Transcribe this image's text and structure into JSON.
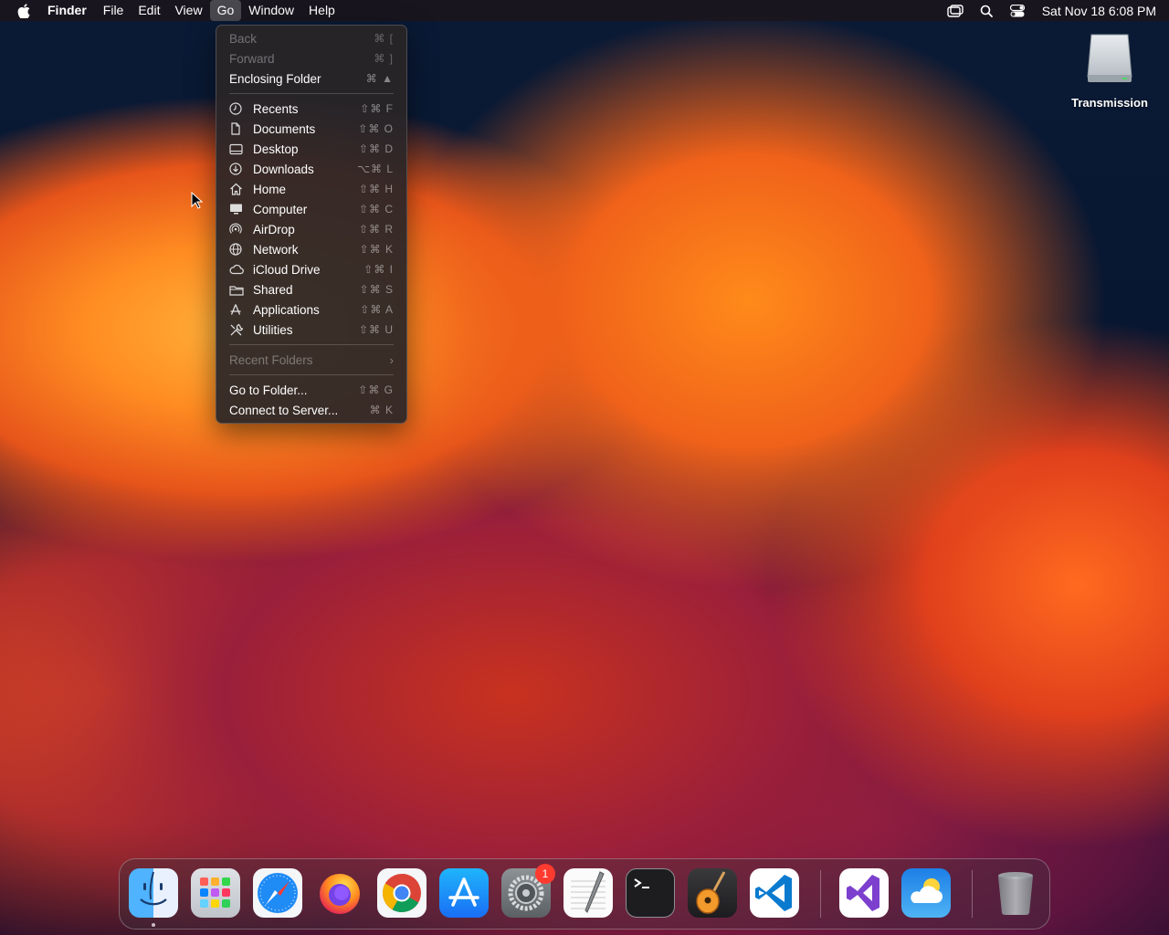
{
  "menubar": {
    "app_name": "Finder",
    "items": [
      "File",
      "Edit",
      "View",
      "Go",
      "Window",
      "Help"
    ],
    "active_item": "Go",
    "clock": "Sat Nov 18  6:08 PM",
    "status_icons": [
      "screen-mirroring-icon",
      "spotlight-search-icon",
      "control-center-icon"
    ]
  },
  "go_menu": {
    "back": {
      "label": "Back",
      "shortcut": "⌘ ["
    },
    "forward": {
      "label": "Forward",
      "shortcut": "⌘ ]"
    },
    "enclosing": {
      "label": "Enclosing Folder",
      "shortcut": "⌘ ▲"
    },
    "places": [
      {
        "label": "Recents",
        "shortcut": "⇧⌘ F",
        "icon": "clock-icon"
      },
      {
        "label": "Documents",
        "shortcut": "⇧⌘ O",
        "icon": "document-icon"
      },
      {
        "label": "Desktop",
        "shortcut": "⇧⌘ D",
        "icon": "desktop-icon"
      },
      {
        "label": "Downloads",
        "shortcut": "⌥⌘ L",
        "icon": "download-icon"
      },
      {
        "label": "Home",
        "shortcut": "⇧⌘ H",
        "icon": "home-icon"
      },
      {
        "label": "Computer",
        "shortcut": "⇧⌘ C",
        "icon": "computer-icon"
      },
      {
        "label": "AirDrop",
        "shortcut": "⇧⌘ R",
        "icon": "airdrop-icon"
      },
      {
        "label": "Network",
        "shortcut": "⇧⌘ K",
        "icon": "globe-icon"
      },
      {
        "label": "iCloud Drive",
        "shortcut": "⇧⌘ I",
        "icon": "cloud-icon"
      },
      {
        "label": "Shared",
        "shortcut": "⇧⌘ S",
        "icon": "shared-folder-icon"
      },
      {
        "label": "Applications",
        "shortcut": "⇧⌘ A",
        "icon": "applications-icon"
      },
      {
        "label": "Utilities",
        "shortcut": "⇧⌘ U",
        "icon": "utilities-icon"
      }
    ],
    "recent_folders": {
      "label": "Recent Folders"
    },
    "go_to_folder": {
      "label": "Go to Folder...",
      "shortcut": "⇧⌘ G"
    },
    "connect_server": {
      "label": "Connect to Server...",
      "shortcut": "⌘ K"
    }
  },
  "desktop": {
    "drive_label": "Transmission"
  },
  "dock": {
    "apps": [
      "Finder",
      "Launchpad",
      "Safari",
      "Firefox",
      "Google Chrome",
      "App Store",
      "System Settings",
      "TextEdit",
      "Terminal",
      "GarageBand",
      "Visual Studio Code",
      "Visual Studio",
      "Weather",
      "Trash"
    ],
    "settings_badge": "1"
  }
}
